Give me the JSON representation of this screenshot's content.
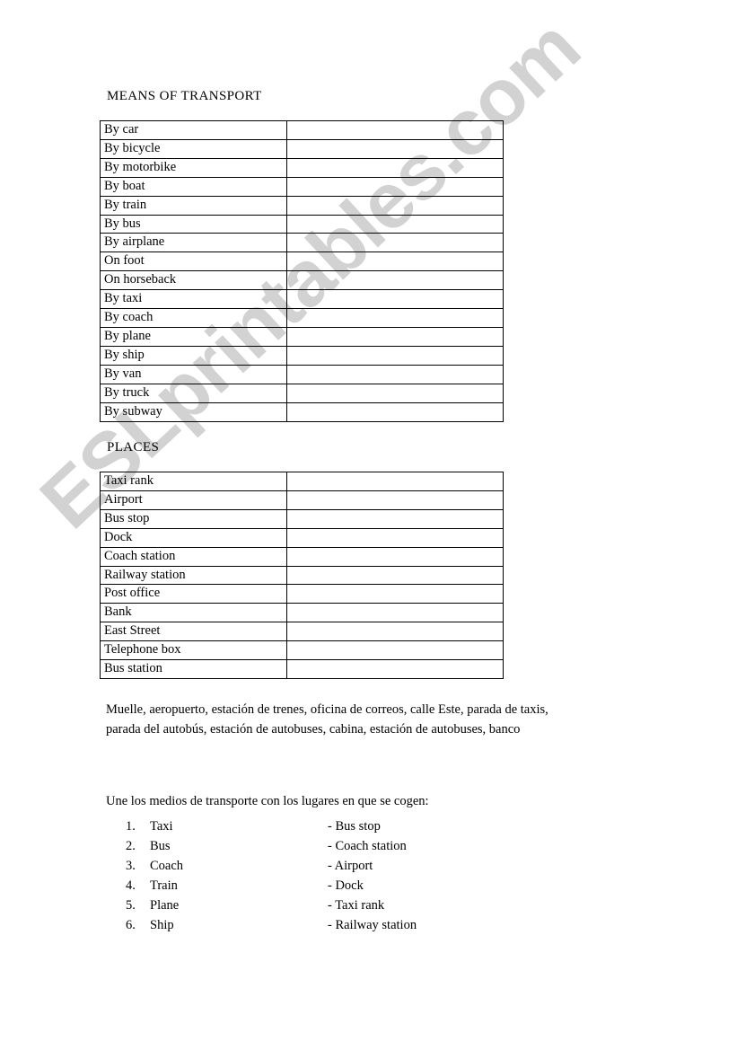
{
  "watermark": {
    "text": "ESLprintables.com",
    "color": "#d2d2d2"
  },
  "sections": {
    "transport": {
      "title": "MEANS OF TRANSPORT",
      "rows": [
        "By car",
        "By bicycle",
        "By motorbike",
        "By boat",
        "By train",
        "By bus",
        "By airplane",
        "On foot",
        "On horseback",
        "By taxi",
        "By coach",
        "By plane",
        "By ship",
        "By van",
        "By truck",
        "By subway"
      ]
    },
    "places": {
      "title": "PLACES",
      "rows": [
        "Taxi rank",
        "Airport",
        "Bus stop",
        "Dock",
        "Coach station",
        "Railway station",
        "Post office",
        "Bank",
        "East Street",
        "Telephone box",
        "Bus station"
      ]
    }
  },
  "wordbank": {
    "line1": "Muelle, aeropuerto, estación de trenes, oficina de correos, calle Este, parada de taxis,",
    "line2": "parada del autobús, estación de autobuses, cabina, estación de autobuses, banco"
  },
  "instruction": "Une los medios de transporte con los lugares en que se cogen:",
  "matching": {
    "items": [
      {
        "num": "1.",
        "left": "Taxi",
        "right": "- Bus stop"
      },
      {
        "num": "2.",
        "left": "Bus",
        "right": "- Coach station"
      },
      {
        "num": "3.",
        "left": "Coach",
        "right": "- Airport"
      },
      {
        "num": "4.",
        "left": "Train",
        "right": "- Dock"
      },
      {
        "num": "5.",
        "left": "Plane",
        "right": "- Taxi rank"
      },
      {
        "num": "6.",
        "left": "Ship",
        "right": "- Railway station"
      }
    ]
  }
}
